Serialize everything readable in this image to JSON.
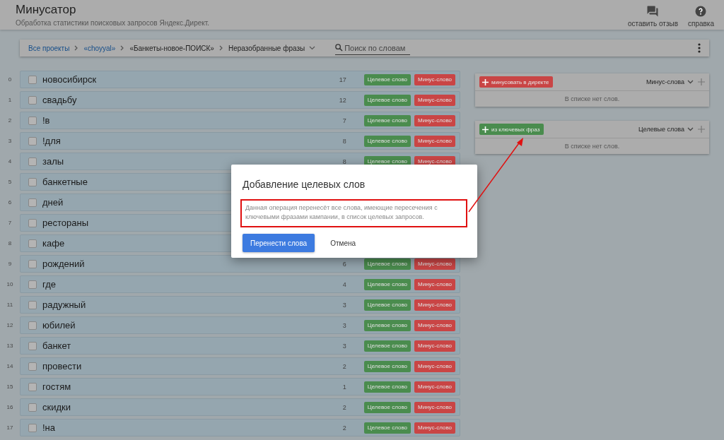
{
  "header": {
    "title": "Минусатор",
    "subtitle": "Обработка статистики поисковых запросов Яндекс.Директ.",
    "actions": [
      {
        "kind": "feedback",
        "label": "оставить отзыв"
      },
      {
        "kind": "help",
        "label": "справка"
      }
    ]
  },
  "breadcrumbs": {
    "items": [
      {
        "label": "Все проекты",
        "link": true
      },
      {
        "label": "«choyyal»",
        "link": true
      },
      {
        "label": "«Банкеты-новое-ПОИСК»",
        "link": false
      },
      {
        "label": "Неразобранные фразы",
        "link": false,
        "dropdown": true
      }
    ],
    "search": {
      "placeholder": "Поиск по словам"
    }
  },
  "words": [
    {
      "index": "0",
      "word": "новосибирск",
      "checked": false,
      "count": "17",
      "target_button": "Целевое слово",
      "minus_button": "Минус-слово"
    },
    {
      "index": "1",
      "word": "свадьбу",
      "checked": false,
      "count": "12",
      "target_button": "Целевое слово",
      "minus_button": "Минус-слово"
    },
    {
      "index": "2",
      "word": "!в",
      "checked": false,
      "count": "7",
      "target_button": "Целевое слово",
      "minus_button": "Минус-слово"
    },
    {
      "index": "3",
      "word": "!для",
      "checked": false,
      "count": "8",
      "target_button": "Целевое слово",
      "minus_button": "Минус-слово"
    },
    {
      "index": "4",
      "word": "залы",
      "checked": false,
      "count": "8",
      "target_button": "Целевое слово",
      "minus_button": "Минус-слово"
    },
    {
      "index": "5",
      "word": "банкетные",
      "checked": false
    },
    {
      "index": "6",
      "word": "дней",
      "checked": false
    },
    {
      "index": "7",
      "word": "рестораны",
      "checked": false
    },
    {
      "index": "8",
      "word": "кафе",
      "checked": false
    },
    {
      "index": "9",
      "word": "рождений",
      "checked": false,
      "count": "6",
      "target_button": "Целевое слово",
      "minus_button": "Минус-слово"
    },
    {
      "index": "10",
      "word": "где",
      "checked": false,
      "count": "4",
      "target_button": "Целевое слово",
      "minus_button": "Минус-слово"
    },
    {
      "index": "11",
      "word": "радужный",
      "checked": false,
      "count": "3",
      "target_button": "Целевое слово",
      "minus_button": "Минус-слово"
    },
    {
      "index": "12",
      "word": "юбилей",
      "checked": false,
      "count": "3",
      "target_button": "Целевое слово",
      "minus_button": "Минус-слово"
    },
    {
      "index": "13",
      "word": "банкет",
      "checked": false,
      "count": "3",
      "target_button": "Целевое слово",
      "minus_button": "Минус-слово"
    },
    {
      "index": "14",
      "word": "провести",
      "checked": false,
      "count": "2",
      "target_button": "Целевое слово",
      "minus_button": "Минус-слово"
    },
    {
      "index": "15",
      "word": "гостям",
      "checked": false,
      "count": "1",
      "target_button": "Целевое слово",
      "minus_button": "Минус-слово"
    },
    {
      "index": "16",
      "word": "скидки",
      "checked": false,
      "count": "2",
      "target_button": "Целевое слово",
      "minus_button": "Минус-слово"
    },
    {
      "index": "17",
      "word": "!на",
      "checked": false,
      "count": "2",
      "target_button": "Целевое слово",
      "minus_button": "Минус-слово"
    }
  ],
  "lists": [
    {
      "button": "минусовать в директе",
      "color": "#c94545",
      "list_name": "Минус-слова",
      "empty_text": "В списке нет слов."
    },
    {
      "button": "из ключевых фраз",
      "color": "#4a8c4e",
      "list_name": "Целевые слова",
      "empty_text": "В списке нет слов."
    }
  ],
  "dialog": {
    "title": "Добавление целевых слов",
    "message": "Данная операция перенесёт все слова, имеющие пересечения с ключевыми фразами кампании, в список целевых запросов.",
    "confirm_button": "Перенести слова",
    "cancel_button": "Отмена",
    "highlighted": true
  }
}
